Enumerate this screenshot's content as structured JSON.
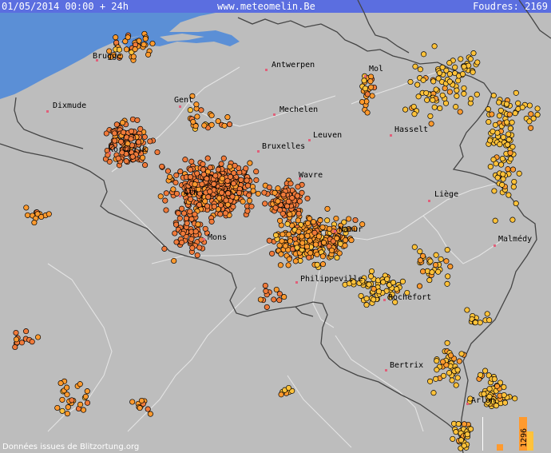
{
  "header": {
    "date_range": "01/05/2014 00:00 + 24h",
    "site": "www.meteomelin.Be",
    "count_label": "Foudres: 2169"
  },
  "footer": {
    "credit": "Données issues de Blitzortung.org"
  },
  "legend": {
    "value": "1296"
  },
  "colors": {
    "land": "#bdbdbd",
    "sea": "#5b8fd6",
    "header_bar": "#5b6ee0",
    "border": "#444444",
    "river": "#e4e4e4",
    "strike_light": "#ffc23a",
    "strike_mid": "#ff9a2e",
    "strike_dark": "#f07a3a",
    "city_marker": "#e0607a"
  },
  "cities": [
    {
      "name": "Brugge"
    },
    {
      "name": "Antwerpen"
    },
    {
      "name": "Mol"
    },
    {
      "name": "Dixmude"
    },
    {
      "name": "Gent"
    },
    {
      "name": "Mechelen"
    },
    {
      "name": "Hasselt"
    },
    {
      "name": "Leuven"
    },
    {
      "name": "Bruxelles"
    },
    {
      "name": "Kortrijk"
    },
    {
      "name": "Wavre"
    },
    {
      "name": "Liège"
    },
    {
      "name": "Ath"
    },
    {
      "name": "Namur"
    },
    {
      "name": "Malmédy"
    },
    {
      "name": "Mons"
    },
    {
      "name": "Philippeville"
    },
    {
      "name": "Rochefort"
    },
    {
      "name": "Bertrix"
    },
    {
      "name": "Arlon"
    }
  ]
}
